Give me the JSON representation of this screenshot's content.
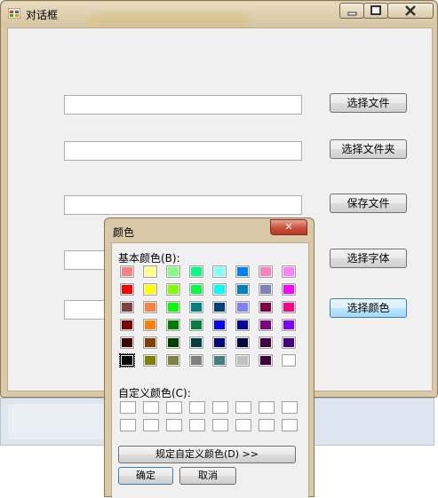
{
  "main_window": {
    "title": "对话框",
    "buttons": [
      "选择文件",
      "选择文件夹",
      "保存文件",
      "选择字体",
      "选择颜色"
    ]
  },
  "color_dialog": {
    "title": "颜色",
    "close_label": "✕",
    "basic_colors_label": "基本颜色(B):",
    "custom_colors_label": "自定义颜色(C):",
    "define_custom_button": "规定自定义颜色(D) >>",
    "ok_button": "确定",
    "cancel_button": "取消",
    "basic_colors": [
      [
        "#ff8080",
        "#ffff80",
        "#80ff80",
        "#00ff80",
        "#80ffff",
        "#0080ff",
        "#ff80c0",
        "#ff80ff"
      ],
      [
        "#ff0000",
        "#ffff00",
        "#80ff00",
        "#00ff40",
        "#00ffff",
        "#0080c0",
        "#8080c0",
        "#ff00ff"
      ],
      [
        "#804040",
        "#ff8040",
        "#00ff00",
        "#008080",
        "#004080",
        "#8080ff",
        "#800040",
        "#ff0080"
      ],
      [
        "#800000",
        "#ff8000",
        "#008000",
        "#008040",
        "#0000ff",
        "#0000a0",
        "#800080",
        "#8000ff"
      ],
      [
        "#400000",
        "#804000",
        "#004000",
        "#004040",
        "#000080",
        "#000040",
        "#400040",
        "#400080"
      ],
      [
        "#000000",
        "#808000",
        "#808040",
        "#808080",
        "#408080",
        "#c0c0c0",
        "#400040",
        "#ffffff"
      ]
    ],
    "selected_color": "#000000"
  }
}
